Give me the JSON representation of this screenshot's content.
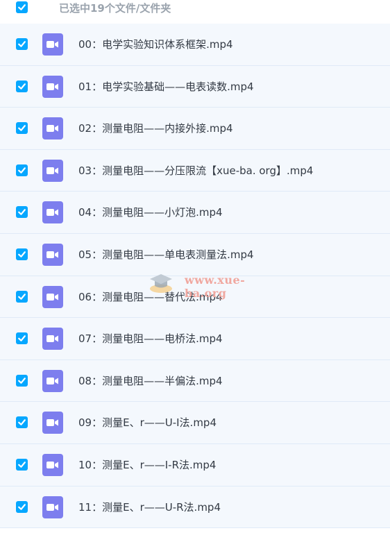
{
  "header": {
    "label": "已选中19个文件/文件夹"
  },
  "files": [
    {
      "name": "00：电学实验知识体系框架.mp4"
    },
    {
      "name": "01：电学实验基础——电表读数.mp4"
    },
    {
      "name": "02：测量电阻——内接外接.mp4"
    },
    {
      "name": "03：测量电阻——分压限流【xue-ba. org】.mp4"
    },
    {
      "name": "04：测量电阻——小灯泡.mp4"
    },
    {
      "name": "05：测量电阻——单电表测量法.mp4"
    },
    {
      "name": "06：测量电阻——替代法.mp4"
    },
    {
      "name": "07：测量电阻——电桥法.mp4"
    },
    {
      "name": "08：测量电阻——半偏法.mp4"
    },
    {
      "name": "09：测量E、r——U-I法.mp4"
    },
    {
      "name": "10：测量E、r——I-R法.mp4"
    },
    {
      "name": "11：测量E、r——U-R法.mp4"
    }
  ],
  "watermark": {
    "text": "www.xue-ba.org"
  },
  "colors": {
    "checkbox": "#06a7ff",
    "video_icon": "#7d7eee",
    "row_bg": "#f4f8fd"
  }
}
